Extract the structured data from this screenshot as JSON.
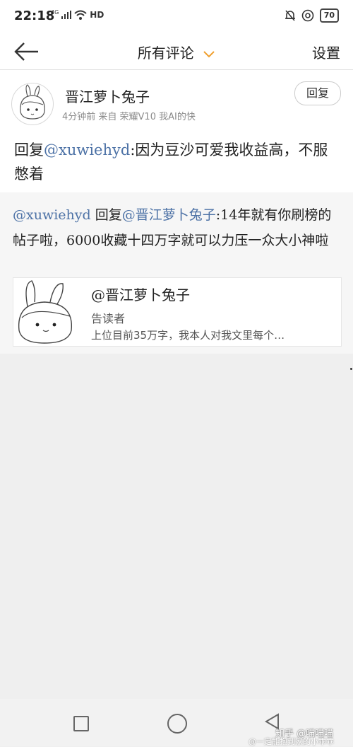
{
  "status_bar": {
    "time": "22:18",
    "network": "4G",
    "hd": "HD",
    "battery": "70"
  },
  "nav": {
    "title": "所有评论",
    "settings": "设置"
  },
  "comment": {
    "author": "晋江萝卜兔子",
    "meta": "4分钟前  来自 荣耀V10 我AI的快",
    "reply_button": "回复",
    "reply_prefix": "回复",
    "mention": "@xuwiehyd",
    "text": ":因为豆沙可爱我收益高，不服憋着"
  },
  "reply": {
    "author_mention": "@xuwiehyd",
    "reply_word": " 回复",
    "target_mention": "@晋江萝卜兔子",
    "text": ":14年就有你刷榜的帖子啦，6000收藏十四万字就可以力压一众大小神啦"
  },
  "card": {
    "title": "@晋江萝卜兔子",
    "subtitle": "告读者",
    "excerpt": "上位目前35万字，我本人对我文里每个…"
  },
  "watermark": {
    "line1": "知乎 @喵喵喵",
    "line2": "@一定能抱到家的小乖乖"
  },
  "colors": {
    "mention": "#4d72a6",
    "accent_chevron": "#f0a030"
  }
}
